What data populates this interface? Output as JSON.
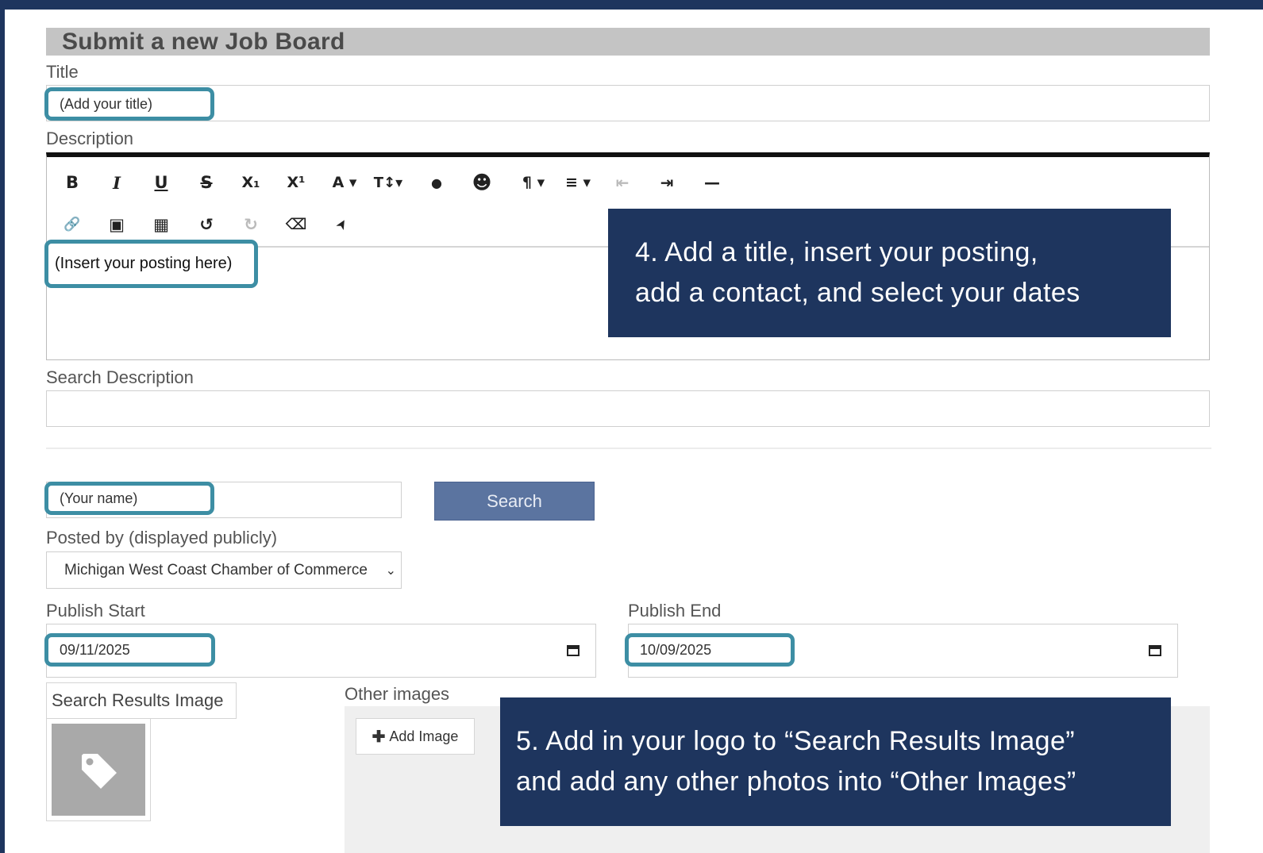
{
  "form": {
    "title": "Submit a new Job Board",
    "title_label": "Title",
    "title_value": "(Add your title)",
    "description_label": "Description",
    "description_value": "(Insert your posting here)",
    "search_description_label": "Search Description",
    "contact_value": "(Your name)",
    "search_button": "Search",
    "posted_by_label": "Posted by (displayed publicly)",
    "posted_by_value": "Michigan West Coast Chamber of Commerce",
    "publish_start_label": "Publish Start",
    "publish_start_value": "09/11/2025",
    "publish_end_label": "Publish End",
    "publish_end_value": "10/09/2025",
    "search_results_image_label": "Search Results Image",
    "other_images_label": "Other images",
    "add_image_button": "Add Image"
  },
  "toolbar": {
    "row1": [
      {
        "icon": "bold-icon",
        "glyph": "B"
      },
      {
        "icon": "italic-icon",
        "glyph": "I"
      },
      {
        "icon": "underline-icon",
        "glyph": "U"
      },
      {
        "icon": "strikethrough-icon",
        "glyph": "S"
      },
      {
        "icon": "subscript-icon",
        "glyph": "X₁"
      },
      {
        "icon": "superscript-icon",
        "glyph": "X¹"
      },
      {
        "icon": "font-color-icon",
        "glyph": "A ▾"
      },
      {
        "icon": "font-size-icon",
        "glyph": "T↕▾"
      },
      {
        "icon": "color-drop-icon",
        "glyph": "●"
      },
      {
        "icon": "emoji-icon",
        "glyph": "☻"
      },
      {
        "icon": "paragraph-icon",
        "glyph": "¶ ▾"
      },
      {
        "icon": "align-icon",
        "glyph": "≡ ▾"
      },
      {
        "icon": "outdent-icon",
        "glyph": "⇤"
      },
      {
        "icon": "indent-icon",
        "glyph": "⇥"
      },
      {
        "icon": "horizontal-rule-icon",
        "glyph": "—"
      }
    ],
    "row2": [
      {
        "icon": "link-icon",
        "glyph": "🔗"
      },
      {
        "icon": "image-icon",
        "glyph": "▣"
      },
      {
        "icon": "table-icon",
        "glyph": "▦"
      },
      {
        "icon": "undo-icon",
        "glyph": "↺"
      },
      {
        "icon": "redo-icon",
        "glyph": "↻"
      },
      {
        "icon": "eraser-icon",
        "glyph": "⌫"
      },
      {
        "icon": "pointer-icon",
        "glyph": "➤"
      }
    ]
  },
  "callouts": {
    "step4_line1": "4. Add a title, insert your posting,",
    "step4_line2": "add a contact, and select your dates",
    "step5_line1": "5. Add in your logo to “Search Results Image”",
    "step5_line2": "and add any other photos into “Other Images”"
  },
  "colors": {
    "frame": "#1e355e",
    "highlight": "#3d8ea4",
    "search_button": "#5b74a0"
  }
}
